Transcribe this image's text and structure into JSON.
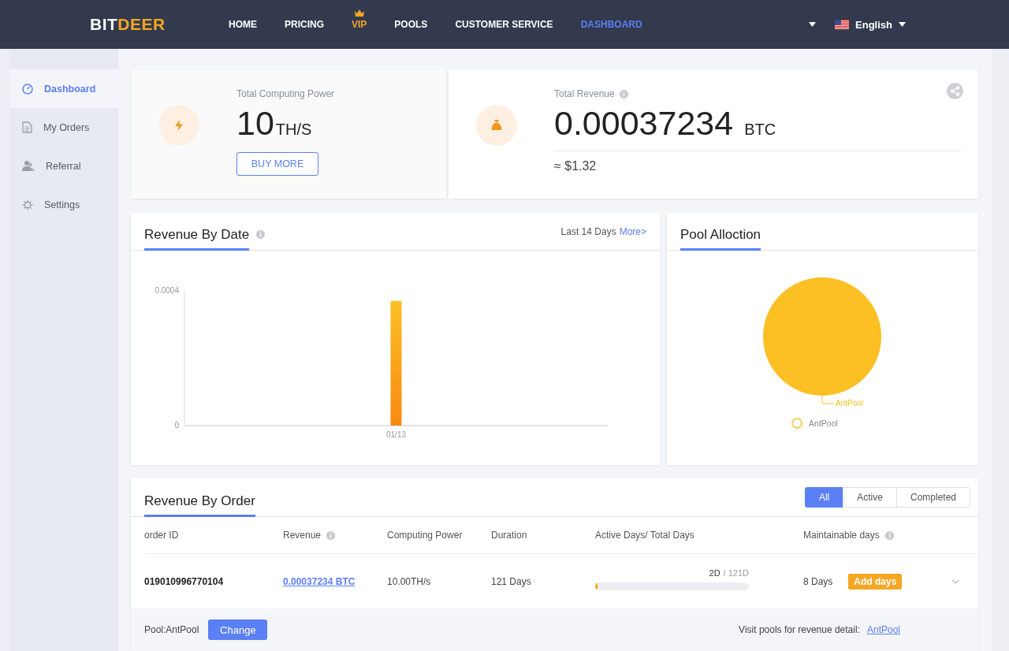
{
  "header": {
    "logo": {
      "part_1": "BIT",
      "part_2": "DEER"
    },
    "nav": [
      {
        "label": "HOME",
        "kind": "plain",
        "selected": false
      },
      {
        "label": "PRICING",
        "kind": "plain",
        "selected": false
      },
      {
        "label": "VIP",
        "kind": "vip",
        "selected": false
      },
      {
        "label": "POOLS",
        "kind": "plain",
        "selected": false
      },
      {
        "label": "CUSTOMER SERVICE",
        "kind": "plain",
        "selected": false
      },
      {
        "label": "DASHBOARD",
        "kind": "plain",
        "selected": true
      }
    ],
    "language": "English"
  },
  "sidebar": {
    "items": [
      {
        "label": "Dashboard",
        "kind": "dashboard",
        "selected": true
      },
      {
        "label": "My Orders",
        "kind": "orders",
        "selected": false
      },
      {
        "label": "Referral",
        "kind": "referral",
        "selected": false
      },
      {
        "label": "Settings",
        "kind": "settings",
        "selected": false
      }
    ]
  },
  "computing": {
    "label": "Total Computing Power",
    "value": "10",
    "unit": "TH/S",
    "button": "BUY MORE"
  },
  "revenue": {
    "label": "Total Revenue",
    "value": "0.00037234",
    "unit": "BTC",
    "fiat": "≈ $1.32"
  },
  "revenue_by_date": {
    "title": "Revenue By Date",
    "range": "Last 14 Days",
    "link": "More>",
    "chart_data": {
      "type": "bar",
      "categories": [
        "01/13"
      ],
      "values": [
        0.00037
      ],
      "ylim": [
        0,
        0.0004
      ],
      "yticks": [
        0,
        0.0004
      ]
    }
  },
  "pool_allocation": {
    "title": "Pool Alloction",
    "chart_data": {
      "type": "pie",
      "categories": [
        "AntPool"
      ],
      "values": [
        100
      ]
    },
    "legend": [
      "AntPool"
    ]
  },
  "revenue_by_order": {
    "title": "Revenue By Order",
    "filters": [
      {
        "label": "All",
        "selected": true
      },
      {
        "label": "Active",
        "selected": false
      },
      {
        "label": "Completed",
        "selected": false
      }
    ],
    "columns": [
      "order ID",
      "Revenue",
      "Computing Power",
      "Duration",
      "Active Days/ Total Days",
      "Maintainable days"
    ],
    "rows": [
      {
        "order_id": "019010996770104",
        "revenue": "0.00037234 BTC",
        "computing_power": "10.00TH/s",
        "duration": "121 Days",
        "active_days": "2D",
        "total_days": "/ 121D",
        "level": 0.0165,
        "maintainable": "8 Days",
        "action": "Add days",
        "expanded": false
      }
    ],
    "footer": {
      "pool": "Pool:AntPool",
      "button": "Change",
      "visit": "Visit pools for revenue detail:",
      "link": "AntPool"
    }
  }
}
